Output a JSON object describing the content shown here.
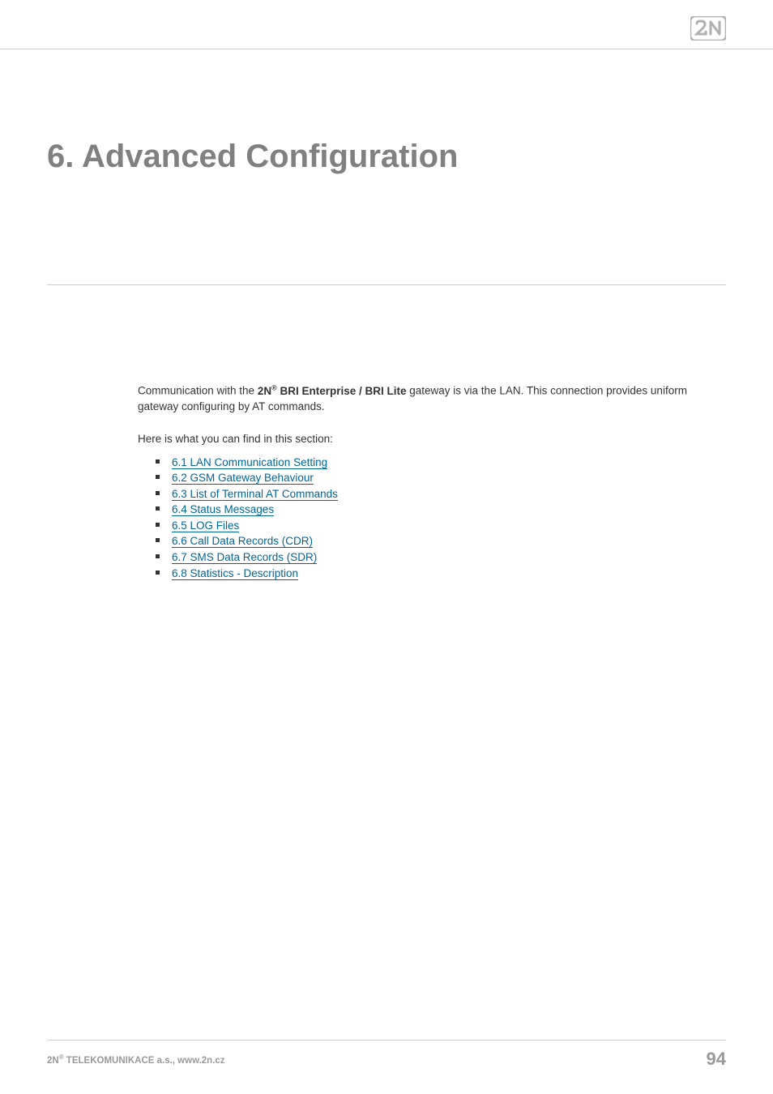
{
  "header": {
    "logo_label": "2N"
  },
  "section": {
    "title": "6. Advanced Configuration"
  },
  "intro": {
    "prefix": "Communication with the ",
    "brand": "2N",
    "brand_suffix": " BRI Enterprise / BRI Lite",
    "rest": " gateway is via the LAN. This connection provides uniform gateway configuring by AT commands."
  },
  "subsection_label": "Here is what you can find in this section:",
  "links": [
    "6.1 LAN Communication Setting",
    "6.2 GSM Gateway Behaviour",
    "6.3 List of Terminal AT Commands",
    "6.4 Status Messages",
    "6.5 LOG Files",
    "6.6 Call Data Records (CDR)",
    "6.7 SMS Data Records (SDR)",
    "6.8 Statistics - Description"
  ],
  "footer": {
    "company_prefix": "2N",
    "company_rest": " TELEKOMUNIKACE a.s., www.2n.cz",
    "page_number": "94"
  }
}
